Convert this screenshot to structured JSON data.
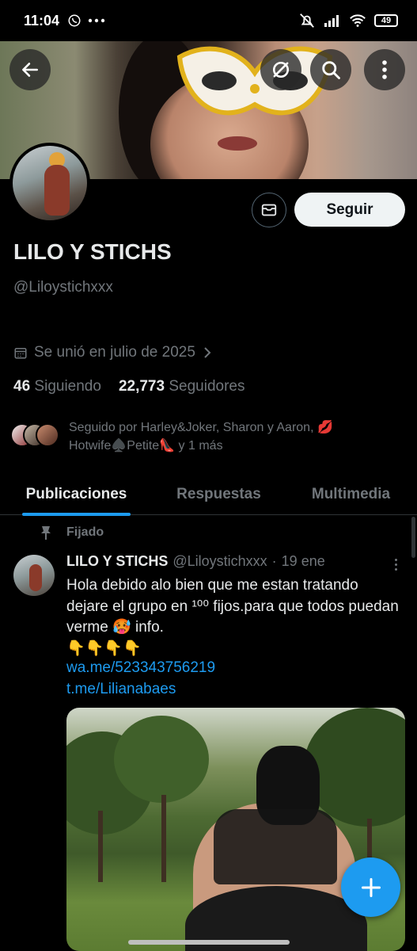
{
  "status_bar": {
    "time": "11:04",
    "battery": "49",
    "icons": [
      "whatsapp-icon",
      "more-dots-icon",
      "mute-icon",
      "signal-icon",
      "wifi-icon",
      "battery-icon"
    ]
  },
  "header": {
    "back_icon": "arrow-left-icon",
    "grok_icon": "grok-icon",
    "search_icon": "search-icon",
    "more_icon": "more-vertical-icon"
  },
  "profile": {
    "display_name": "LILO Y STICHS",
    "handle": "@Liloystichxxx",
    "joined": "Se unió en julio de 2025",
    "following_count": "46",
    "following_label": "Siguiendo",
    "followers_count": "22,773",
    "followers_label": "Seguidores",
    "followed_by": "Seguido por Harley&Joker, Sharon y Aaron, 💋 Hotwife♠️Petite👠 y 1 más",
    "follow_label": "Seguir"
  },
  "tabs": [
    {
      "label": "Publicaciones",
      "active": true
    },
    {
      "label": "Respuestas",
      "active": false
    },
    {
      "label": "Multimedia",
      "active": false
    }
  ],
  "pinned_label": "Fijado",
  "post": {
    "author_name": "LILO Y STICHS",
    "author_handle": "@Liloystichxxx",
    "separator": "·",
    "date": "19 ene",
    "text": "Hola debido alo bien que me estan tratando dejare el grupo en ¹⁰⁰ fijos.para que todos puedan verme 🥵 info.",
    "emoji_line": "👇👇👇👇",
    "links": [
      "wa.me/523343756219",
      "t.me/Lilianabaes"
    ]
  },
  "colors": {
    "accent": "#1d9bf0",
    "text_primary": "#e7e9ea",
    "text_secondary": "#71767b",
    "background": "#000000"
  }
}
